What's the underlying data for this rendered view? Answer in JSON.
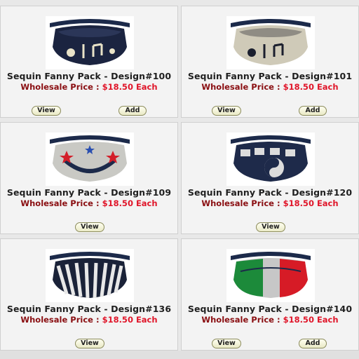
{
  "products": [
    {
      "title": "Sequin Fanny Pack - Design#100",
      "price_label": "Wholesale Price :",
      "price": "$18.50 Each",
      "view_label": "View",
      "add_label": "Add",
      "has_add": true,
      "design": "music-white",
      "colors": {
        "strap": "#1c2a4a",
        "body": "#1b2440",
        "accent": "#e9e3c8"
      }
    },
    {
      "title": "Sequin Fanny Pack - Design#101",
      "price_label": "Wholesale Price :",
      "price": "$18.50 Each",
      "view_label": "View",
      "add_label": "Add",
      "has_add": true,
      "design": "music-silver",
      "colors": {
        "strap": "#1c2a4a",
        "body": "#cfcab8",
        "accent": "#1b1f2e"
      }
    },
    {
      "title": "Sequin Fanny Pack - Design#109",
      "price_label": "Wholesale Price :",
      "price": "$18.50 Each",
      "view_label": "View",
      "has_add": false,
      "design": "smiley-stars",
      "colors": {
        "strap": "#1c2a4a",
        "body": "#c9c9c4",
        "accent": "#d31f2a"
      }
    },
    {
      "title": "Sequin Fanny Pack - Design#120",
      "price_label": "Wholesale Price :",
      "price": "$18.50 Each",
      "view_label": "View",
      "has_add": false,
      "design": "yin-yang",
      "colors": {
        "strap": "#1c2a4a",
        "body": "#1e2a4a",
        "accent": "#dcdcdc"
      }
    },
    {
      "title": "Sequin Fanny Pack - Design#136",
      "price_label": "Wholesale Price :",
      "price": "$18.50 Each",
      "view_label": "View",
      "has_add": false,
      "design": "zebra",
      "colors": {
        "strap": "#1c2a4a",
        "body": "#1a2238",
        "accent": "#e8e8e8"
      }
    },
    {
      "title": "Sequin Fanny Pack - Design#140",
      "price_label": "Wholesale Price :",
      "price": "$18.50 Each",
      "view_label": "View",
      "add_label": "Add",
      "has_add": true,
      "design": "italy-flag",
      "colors": {
        "strap": "#1c2a4a",
        "body": "#c7c7c7",
        "accent": "#1c8a3a",
        "accent2": "#d61b26"
      }
    }
  ]
}
